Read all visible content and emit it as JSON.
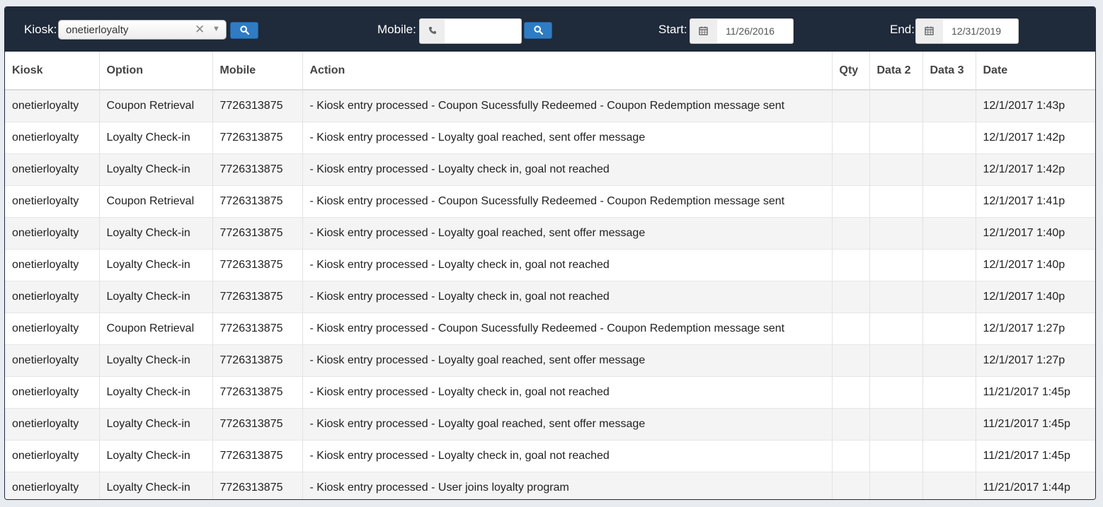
{
  "filters": {
    "kiosk_label": "Kiosk:",
    "kiosk_value": "onetierloyalty",
    "clear_symbol": "✕",
    "mobile_label": "Mobile:",
    "mobile_value": "",
    "start_label": "Start:",
    "start_value": "11/26/2016",
    "end_label": "End:",
    "end_value": "12/31/2019"
  },
  "icons": {
    "search": "search-icon",
    "phone": "phone-icon",
    "calendar": "calendar-icon",
    "clear": "close-icon",
    "dropdown": "chevron-down-icon"
  },
  "colors": {
    "toolbar_bg": "#1f2a3a",
    "search_button": "#2f7cc4"
  },
  "table": {
    "columns": [
      "Kiosk",
      "Option",
      "Mobile",
      "Action",
      "Qty",
      "Data 2",
      "Data 3",
      "Date"
    ],
    "rows": [
      [
        "onetierloyalty",
        "Coupon Retrieval",
        "7726313875",
        "- Kiosk entry processed - Coupon Sucessfully Redeemed - Coupon Redemption message sent",
        "",
        "",
        "",
        "12/1/2017 1:43p"
      ],
      [
        "onetierloyalty",
        "Loyalty Check-in",
        "7726313875",
        "- Kiosk entry processed - Loyalty goal reached, sent offer message",
        "",
        "",
        "",
        "12/1/2017 1:42p"
      ],
      [
        "onetierloyalty",
        "Loyalty Check-in",
        "7726313875",
        "- Kiosk entry processed - Loyalty check in, goal not reached",
        "",
        "",
        "",
        "12/1/2017 1:42p"
      ],
      [
        "onetierloyalty",
        "Coupon Retrieval",
        "7726313875",
        "- Kiosk entry processed - Coupon Sucessfully Redeemed - Coupon Redemption message sent",
        "",
        "",
        "",
        "12/1/2017 1:41p"
      ],
      [
        "onetierloyalty",
        "Loyalty Check-in",
        "7726313875",
        "- Kiosk entry processed - Loyalty goal reached, sent offer message",
        "",
        "",
        "",
        "12/1/2017 1:40p"
      ],
      [
        "onetierloyalty",
        "Loyalty Check-in",
        "7726313875",
        "- Kiosk entry processed - Loyalty check in, goal not reached",
        "",
        "",
        "",
        "12/1/2017 1:40p"
      ],
      [
        "onetierloyalty",
        "Loyalty Check-in",
        "7726313875",
        "- Kiosk entry processed - Loyalty check in, goal not reached",
        "",
        "",
        "",
        "12/1/2017 1:40p"
      ],
      [
        "onetierloyalty",
        "Coupon Retrieval",
        "7726313875",
        "- Kiosk entry processed - Coupon Sucessfully Redeemed - Coupon Redemption message sent",
        "",
        "",
        "",
        "12/1/2017 1:27p"
      ],
      [
        "onetierloyalty",
        "Loyalty Check-in",
        "7726313875",
        "- Kiosk entry processed - Loyalty goal reached, sent offer message",
        "",
        "",
        "",
        "12/1/2017 1:27p"
      ],
      [
        "onetierloyalty",
        "Loyalty Check-in",
        "7726313875",
        "- Kiosk entry processed - Loyalty check in, goal not reached",
        "",
        "",
        "",
        "11/21/2017 1:45p"
      ],
      [
        "onetierloyalty",
        "Loyalty Check-in",
        "7726313875",
        "- Kiosk entry processed - Loyalty goal reached, sent offer message",
        "",
        "",
        "",
        "11/21/2017 1:45p"
      ],
      [
        "onetierloyalty",
        "Loyalty Check-in",
        "7726313875",
        "- Kiosk entry processed - Loyalty check in, goal not reached",
        "",
        "",
        "",
        "11/21/2017 1:45p"
      ],
      [
        "onetierloyalty",
        "Loyalty Check-in",
        "7726313875",
        "- Kiosk entry processed - User joins loyalty program",
        "",
        "",
        "",
        "11/21/2017 1:44p"
      ]
    ]
  }
}
